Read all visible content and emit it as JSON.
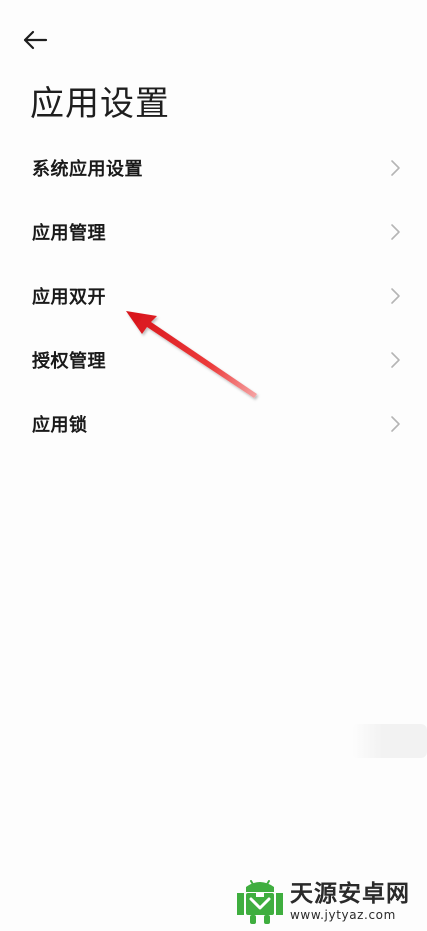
{
  "header": {
    "back_icon": "arrow-left-icon",
    "title": "应用设置"
  },
  "menu": {
    "items": [
      {
        "label": "系统应用设置",
        "icon": "chevron-right-icon"
      },
      {
        "label": "应用管理",
        "icon": "chevron-right-icon"
      },
      {
        "label": "应用双开",
        "icon": "chevron-right-icon"
      },
      {
        "label": "授权管理",
        "icon": "chevron-right-icon"
      },
      {
        "label": "应用锁",
        "icon": "chevron-right-icon"
      }
    ]
  },
  "annotation": {
    "icon": "red-arrow-annotation",
    "color": "#e0191f",
    "points_to": "应用双开"
  },
  "watermark": {
    "name": "天源安卓网",
    "url": "www.jytyaz.com",
    "logo_icon": "android-robot-logo",
    "logo_color": "#3fae3f"
  },
  "colors": {
    "background": "#fdfdfd",
    "text": "#1a1a1a",
    "chevron": "#b5b5b5"
  }
}
